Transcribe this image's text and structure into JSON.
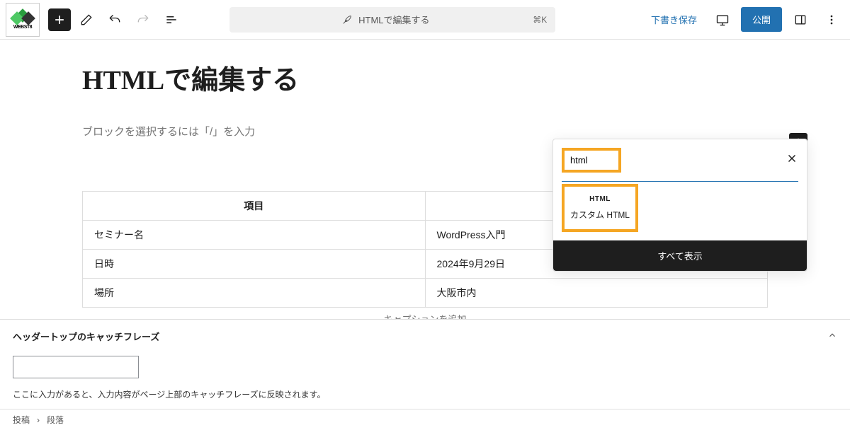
{
  "logo_text": "WEBST8",
  "toolbar": {
    "center_text": "HTMLで編集する",
    "shortcut": "⌘K",
    "draft_save": "下書き保存",
    "publish": "公開"
  },
  "editor": {
    "title": "HTMLで編集する",
    "block_prompt": "ブロックを選択するには「/」を入力"
  },
  "table": {
    "headers": [
      "項目",
      ""
    ],
    "rows": [
      {
        "label": "セミナー名",
        "value": "WordPress入門"
      },
      {
        "label": "日時",
        "value": "2024年9月29日"
      },
      {
        "label": "場所",
        "value": "大阪市内"
      }
    ],
    "caption": "キャプションを追加"
  },
  "inserter": {
    "search_value": "html",
    "block_icon_text": "HTML",
    "block_label": "カスタム HTML",
    "show_all": "すべて表示"
  },
  "metabox": {
    "title": "ヘッダートップのキャッチフレーズ",
    "description": "ここに入力があると、入力内容がページ上部のキャッチフレーズに反映されます。"
  },
  "breadcrumb": {
    "root": "投稿",
    "sep": "›",
    "current": "段落"
  }
}
